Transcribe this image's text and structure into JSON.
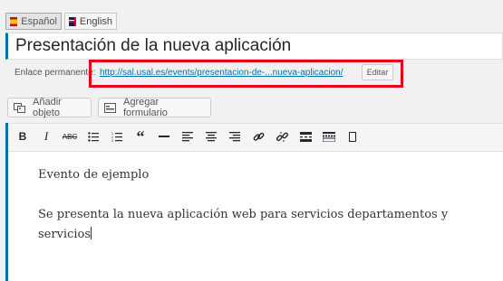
{
  "language_tabs": [
    {
      "label": "Español",
      "active": true,
      "flag": "es-flag-icon"
    },
    {
      "label": "English",
      "active": false,
      "flag": "uk-flag-icon"
    }
  ],
  "title": {
    "value": "Presentación de la nueva aplicación"
  },
  "permalink": {
    "label": "Enlace permanente:",
    "url_text": "http://sal.usal.es/events/presentacion-de-...nueva-aplicacion/",
    "edit_label": "Editar"
  },
  "media_buttons": {
    "add_object": "Añadir objeto",
    "add_form": "Agregar formulario"
  },
  "toolbar": {
    "icons": [
      "bold-icon",
      "italic-icon",
      "strikethrough-icon",
      "bullet-list-icon",
      "numbered-list-icon",
      "blockquote-icon",
      "horizontal-rule-icon",
      "align-left-icon",
      "align-center-icon",
      "align-right-icon",
      "link-icon",
      "unlink-icon",
      "read-more-icon",
      "toolbar-toggle-icon",
      "fullscreen-icon"
    ]
  },
  "content": {
    "paragraph_1": "Evento de ejemplo",
    "paragraph_2_line_1": "Se presenta la nueva aplicación web para servicios departamentos y",
    "paragraph_2_line_2": "servicios"
  },
  "colors": {
    "accent": "#0073aa",
    "highlight": "#e3001b"
  }
}
